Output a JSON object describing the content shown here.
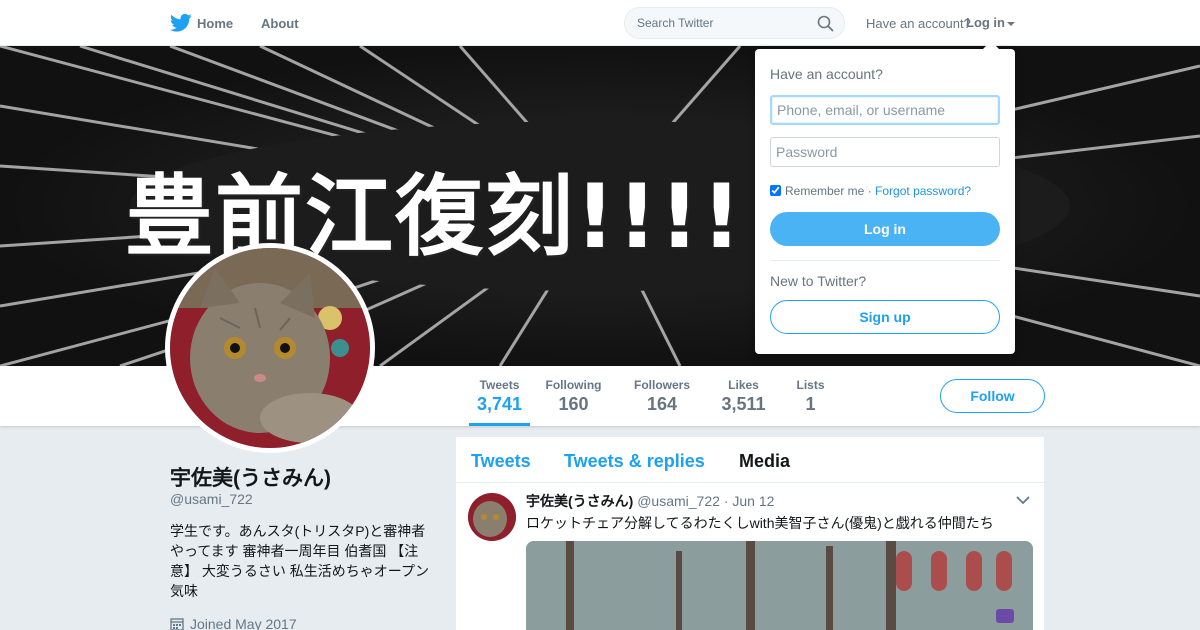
{
  "nav": {
    "home": "Home",
    "about": "About",
    "search_placeholder": "Search Twitter",
    "have_account": "Have an account?",
    "login": "Log in",
    "logo_icon": "twitter-bird-icon",
    "accent": "#1da1f2"
  },
  "banner": {
    "text": "豊前江復刻!!!!"
  },
  "profile": {
    "name": "宇佐美(うさみん)",
    "handle": "@usami_722",
    "bio": "学生です。あんスタ(トリスタP)と審神者やってます 審神者一周年目 伯耆国 【注意】 大変うるさい 私生活めちゃオープン気味",
    "joined": "Joined May 2017"
  },
  "stats": [
    {
      "label": "Tweets",
      "value": "3,741"
    },
    {
      "label": "Following",
      "value": "160"
    },
    {
      "label": "Followers",
      "value": "164"
    },
    {
      "label": "Likes",
      "value": "3,511"
    },
    {
      "label": "Lists",
      "value": "1"
    }
  ],
  "follow_label": "Follow",
  "tabs": [
    "Tweets",
    "Tweets & replies",
    "Media"
  ],
  "tweet": {
    "name": "宇佐美(うさみん)",
    "handle": "@usami_722",
    "dot": "·",
    "date": "Jun 12",
    "text": "ロケットチェア分解してるわたくしwith美智子さん(優鬼)と戯れる仲間たち"
  },
  "login_dropdown": {
    "title": "Have an account?",
    "username_placeholder": "Phone, email, or username",
    "password_placeholder": "Password",
    "remember": "Remember me",
    "sep": "·",
    "forgot": "Forgot password?",
    "login_button": "Log in",
    "new_to_twitter": "New to Twitter?",
    "signup_button": "Sign up"
  }
}
